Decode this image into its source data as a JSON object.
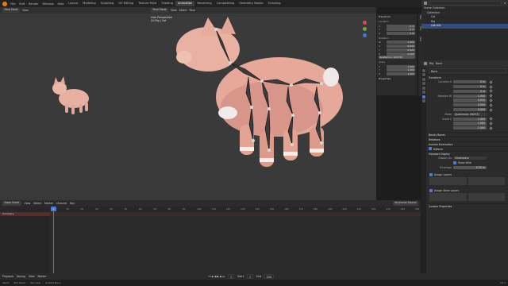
{
  "topbar": {
    "menus": [
      "File",
      "Edit",
      "Render",
      "Window",
      "Help"
    ],
    "tabs": [
      "Layout",
      "Modeling",
      "Sculpting",
      "UV Editing",
      "Texture Paint",
      "Shading",
      "Animation",
      "Rendering",
      "Compositing",
      "Geometry Nodes",
      "Scripting"
    ],
    "active_tab": "Animation",
    "scene": "Scene",
    "view_layer": "ViewLayer"
  },
  "left_viewport": {
    "mode": "Pose Mode",
    "menus": [
      "View"
    ],
    "overlay_line1": "User Perspective",
    "overlay_line2": "(1) Rig"
  },
  "main_viewport": {
    "mode": "Pose Mode",
    "menus": [
      "View",
      "Select",
      "Pose"
    ],
    "overlay_line1": "User Perspective",
    "overlay_line2": "(1) Rig | Cat",
    "options": "Options"
  },
  "npanel": {
    "title": "Transform",
    "location_label": "Location",
    "rotation_label": "Rotation",
    "scale_label": "Scale",
    "rows": [
      {
        "axis": "X",
        "value": "0 m"
      },
      {
        "axis": "Y",
        "value": "0 m"
      },
      {
        "axis": "Z",
        "value": "0 m"
      }
    ],
    "rot_rows": [
      {
        "axis": "W",
        "value": "1.000"
      },
      {
        "axis": "X",
        "value": "0.000"
      },
      {
        "axis": "Y",
        "value": "0.000"
      },
      {
        "axis": "Z",
        "value": "0.000"
      }
    ],
    "rot_mode": "Quaternion (WXYZ)",
    "scale_rows": [
      {
        "axis": "X",
        "value": "1.000"
      },
      {
        "axis": "Y",
        "value": "1.000"
      },
      {
        "axis": "Z",
        "value": "1.000"
      }
    ],
    "properties_label": "Properties",
    "tabs": [
      "Item",
      "Tool",
      "View"
    ]
  },
  "outliner": {
    "search": "",
    "items": [
      {
        "label": "Scene Collection",
        "state": "normal"
      },
      {
        "label": "Collection",
        "state": "alt"
      },
      {
        "label": "Cat",
        "state": "normal"
      },
      {
        "label": "Rig",
        "state": "alt"
      },
      {
        "label": "Cat.001",
        "state": "selected"
      }
    ]
  },
  "properties": {
    "header_items": [
      "Rig",
      "Bone"
    ],
    "bone_name": "Bone",
    "sections": {
      "transform": "Transform",
      "bendy": "Bendy Bones",
      "relations": "Relations",
      "inverse": "Inverse Kinematics",
      "deform": "Deform",
      "viewport": "Viewport Display",
      "custom": "Custom Properties"
    },
    "location_label": "Location X",
    "loc": [
      "0 m",
      "0 m",
      "0 m"
    ],
    "rot_label": "Rotation W",
    "rot": [
      "1.000",
      "0.000",
      "0.000",
      "0.000"
    ],
    "mode_label": "Mode",
    "mode": "Quaternion (WXYZ)",
    "scale_label": "Scale X",
    "scale": [
      "1.000",
      "1.000",
      "1.000"
    ],
    "display_as_label": "Display As",
    "display_as": "Octahedral",
    "show_wire": "Show Wire",
    "deform_checked": "Deform",
    "envelope_label": "Envelope",
    "envelope_value": "0.25 m",
    "assign_layers": "Assign Layers",
    "assign_bone_layers": "Assign Bone Layers"
  },
  "timeline": {
    "editor": "Dope Sheet",
    "menus": [
      "View",
      "Select",
      "Marker",
      "Channel",
      "Key"
    ],
    "mode": "Keyframe Source",
    "summary": "Summary",
    "current_frame": "1",
    "ticks": [
      "0",
      "10",
      "20",
      "30",
      "40",
      "50",
      "60",
      "70",
      "80",
      "90",
      "100",
      "110",
      "120",
      "130",
      "140",
      "150",
      "160",
      "170",
      "180",
      "190",
      "200",
      "210",
      "220",
      "230",
      "240",
      "250"
    ]
  },
  "bottom": {
    "menus": [
      "Playback",
      "Keying",
      "View",
      "Marker"
    ],
    "start_label": "Start",
    "start": "1",
    "end_label": "End",
    "end": "250"
  },
  "status": {
    "items": [
      "Select",
      "Box Select",
      "Pan View",
      "Context Menu"
    ],
    "version": "3.4.1"
  }
}
